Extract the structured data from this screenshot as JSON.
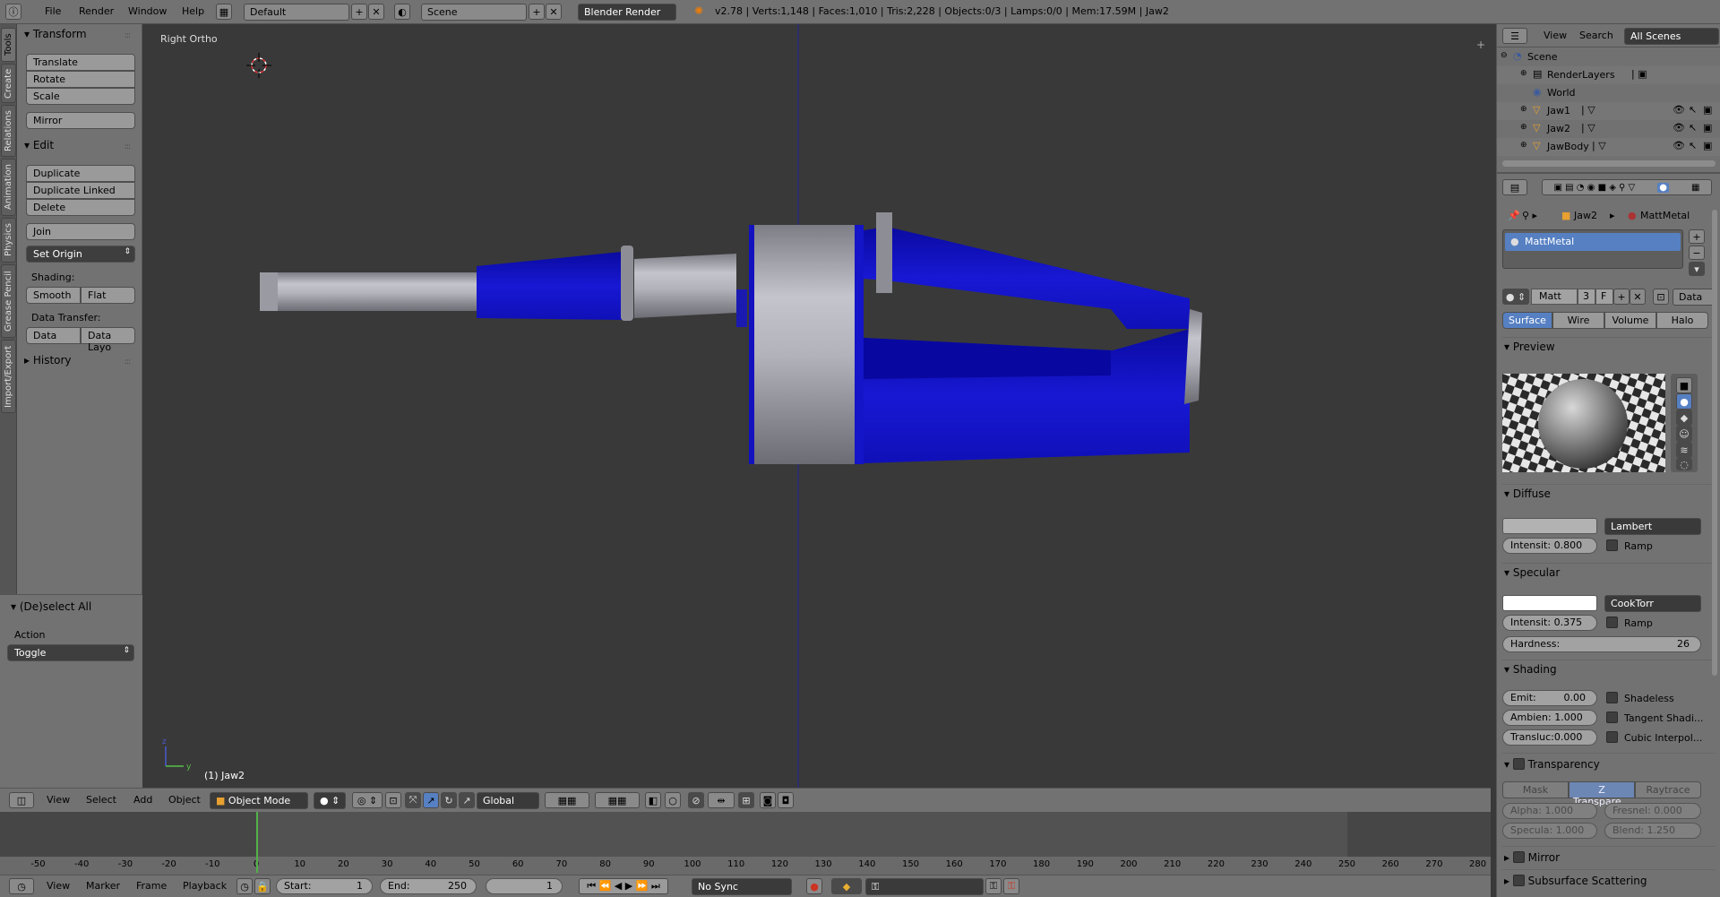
{
  "topbar": {
    "menus": [
      "File",
      "Render",
      "Window",
      "Help"
    ],
    "layout": "Default",
    "scene": "Scene",
    "engine": "Blender Render",
    "stats": "v2.78 | Verts:1,148 | Faces:1,010 | Tris:2,228 | Objects:0/3 | Lamps:0/0 | Mem:17.59M | Jaw2"
  },
  "tabs": [
    "Tools",
    "Create",
    "Relations",
    "Animation",
    "Physics",
    "Grease Pencil",
    "Import/Export"
  ],
  "tools": {
    "transform_title": "Transform",
    "translate": "Translate",
    "rotate": "Rotate",
    "scale": "Scale",
    "mirror": "Mirror",
    "edit_title": "Edit",
    "duplicate": "Duplicate",
    "duplicate_linked": "Duplicate Linked",
    "delete": "Delete",
    "join": "Join",
    "set_origin": "Set Origin",
    "shading_label": "Shading:",
    "smooth": "Smooth",
    "flat": "Flat",
    "data_transfer_label": "Data Transfer:",
    "data": "Data",
    "data_layout": "Data Layo",
    "history_title": "History",
    "operator_title": "(De)select All",
    "action_label": "Action",
    "action_value": "Toggle"
  },
  "viewport": {
    "view_name": "Right Ortho",
    "object_label": "(1) Jaw2",
    "axis_x": "y",
    "axis_z": "z"
  },
  "vpheader": {
    "menus": [
      "View",
      "Select",
      "Add",
      "Object"
    ],
    "mode": "Object Mode",
    "orientation": "Global"
  },
  "timeline": {
    "ticks": [
      -50,
      -40,
      -30,
      -20,
      -10,
      0,
      10,
      20,
      30,
      40,
      50,
      60,
      70,
      80,
      90,
      100,
      110,
      120,
      130,
      140,
      150,
      160,
      170,
      180,
      190,
      200,
      210,
      220,
      230,
      240,
      250,
      260,
      270,
      280
    ],
    "current_frame": 1,
    "menus": [
      "View",
      "Marker",
      "Frame",
      "Playback"
    ],
    "start_label": "Start:",
    "start": "1",
    "end_label": "End:",
    "end": "250",
    "frame": "1",
    "sync": "No Sync"
  },
  "outliner": {
    "menus": [
      "View",
      "Search"
    ],
    "filter": "All Scenes",
    "items": [
      {
        "name": "Scene"
      },
      {
        "name": "RenderLayers"
      },
      {
        "name": "World"
      },
      {
        "name": "Jaw1"
      },
      {
        "name": "Jaw2"
      },
      {
        "name": "JawBody"
      }
    ]
  },
  "props": {
    "breadcrumb_object": "Jaw2",
    "breadcrumb_material": "MattMetal",
    "material_slot": "MattMetal",
    "material_name": "Matt",
    "users": "3",
    "fake": "F",
    "link": "Data",
    "tabs": [
      "Surface",
      "Wire",
      "Volume",
      "Halo"
    ],
    "preview_title": "Preview",
    "diffuse_title": "Diffuse",
    "diffuse_shader": "Lambert",
    "diffuse_intensity": "Intensit: 0.800",
    "ramp": "Ramp",
    "specular_title": "Specular",
    "specular_shader": "CookTorr",
    "specular_intensity": "Intensit: 0.375",
    "hardness_label": "Hardness:",
    "hardness": "26",
    "shading_title": "Shading",
    "emit": "Emit:",
    "emit_value": "0.00",
    "ambient": "Ambien: 1.000",
    "transluc": "Transluc:0.000",
    "shadeless": "Shadeless",
    "tangent": "Tangent Shadi...",
    "cubic": "Cubic Interpol...",
    "transparency_title": "Transparency",
    "trans_tabs": [
      "Mask",
      "Z Transpare...",
      "Raytrace"
    ],
    "alpha": "Alpha:  1.000",
    "fresnel": "Fresnel:  0.000",
    "specula": "Specula:  1.000",
    "blend": "Blend:  1.250",
    "mirror_title": "Mirror",
    "sss_title": "Subsurface Scattering"
  },
  "colors": {
    "blue": "#1414c8",
    "metal": "#b4b4be",
    "ui": "#727272",
    "highlight": "#5680c2"
  }
}
